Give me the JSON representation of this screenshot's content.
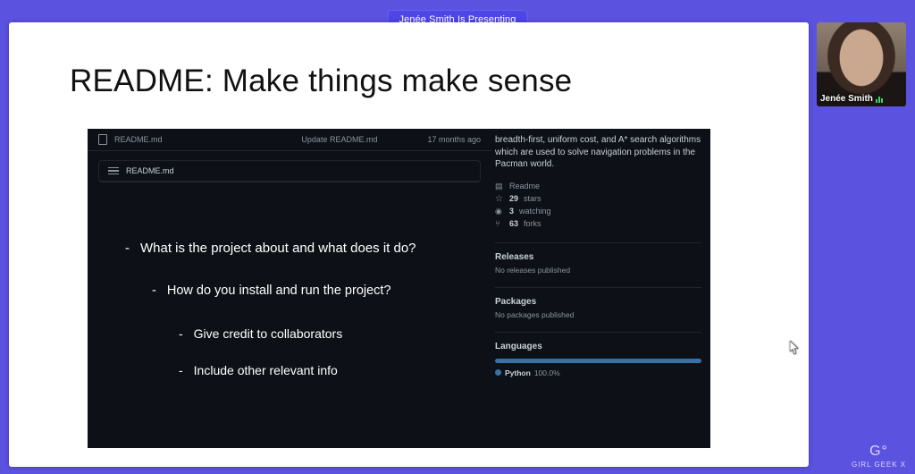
{
  "presenting_banner": "Jenée Smith Is Presenting",
  "slide": {
    "title": "README: Make things make sense",
    "github_panel": {
      "filebar": {
        "filename": "README.md",
        "commit_msg": "Update README.md",
        "time_ago": "17 months ago"
      },
      "readme_header": "README.md",
      "bullets": {
        "b1": "What is the project about and what does it do?",
        "b2": "How do you install and run the project?",
        "b3": "Give credit to collaborators",
        "b4": "Include other relevant info"
      },
      "sidebar": {
        "description": "breadth-first, uniform cost, and A* search algorithms which are used to solve navigation problems in the Pacman world.",
        "readme_label": "Readme",
        "stars_count": "29",
        "stars_label": "stars",
        "watching_count": "3",
        "watching_label": "watching",
        "forks_count": "63",
        "forks_label": "forks",
        "releases_heading": "Releases",
        "releases_sub": "No releases published",
        "packages_heading": "Packages",
        "packages_sub": "No packages published",
        "languages_heading": "Languages",
        "lang_name": "Python",
        "lang_pct": "100.0%"
      }
    }
  },
  "presenter": {
    "name": "Jenée Smith"
  },
  "watermark": {
    "glyph": "G°",
    "label": "GIRL GEEK X"
  }
}
